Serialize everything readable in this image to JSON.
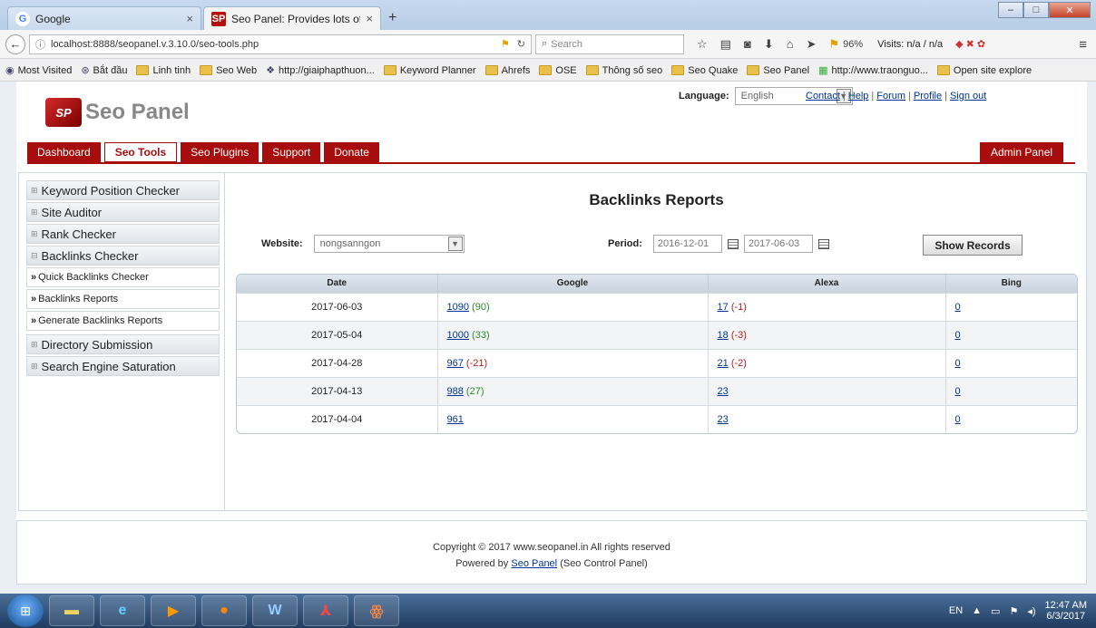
{
  "browser": {
    "tabs": [
      {
        "title": "Google",
        "favicon": "G"
      },
      {
        "title": "Seo Panel: Provides lots of hc",
        "favicon": "SP"
      }
    ],
    "url": "localhost:8888/seopanel.v.3.10.0/seo-tools.php",
    "search_placeholder": "Search",
    "zoom": "96%",
    "visits": "Visits: n/a / n/a",
    "bookmarks": [
      "Most Visited",
      "Bắt đầu",
      "Linh tinh",
      "Seo Web",
      "http://giaiphapthuon...",
      "Keyword Planner",
      "Ahrefs",
      "OSE",
      "Thông số seo",
      "Seo Quake",
      "Seo Panel",
      "http://www.traonguo...",
      "Open site explore"
    ]
  },
  "header": {
    "logo_mark": "SP",
    "logo_text": "Seo Panel",
    "language_label": "Language:",
    "language_value": "English",
    "links": [
      "Contact",
      "Help",
      "Forum",
      "Profile",
      "Sign out"
    ]
  },
  "menu": {
    "items": [
      "Dashboard",
      "Seo Tools",
      "Seo Plugins",
      "Support",
      "Donate"
    ],
    "active": "Seo Tools",
    "admin": "Admin Panel"
  },
  "sidebar": {
    "items": [
      {
        "label": "Keyword Position Checker"
      },
      {
        "label": "Site Auditor"
      },
      {
        "label": "Rank Checker"
      },
      {
        "label": "Backlinks Checker"
      },
      {
        "label": "Directory Submission"
      },
      {
        "label": "Search Engine Saturation"
      }
    ],
    "sub_items": [
      "Quick Backlinks Checker",
      "Backlinks Reports",
      "Generate Backlinks Reports"
    ]
  },
  "report": {
    "title": "Backlinks Reports",
    "website_label": "Website:",
    "website_value": "nongsanngon",
    "period_label": "Period:",
    "date_from": "2016-12-01",
    "date_to": "2017-06-03",
    "show_button": "Show Records",
    "columns": [
      "Date",
      "Google",
      "Alexa",
      "Bing"
    ],
    "rows": [
      {
        "date": "2017-06-03",
        "google": "1090",
        "google_diff": "(90)",
        "google_diff_sign": "pos",
        "alexa": "17",
        "alexa_diff": "(-1)",
        "alexa_diff_sign": "neg",
        "bing": "0"
      },
      {
        "date": "2017-05-04",
        "google": "1000",
        "google_diff": "(33)",
        "google_diff_sign": "pos",
        "alexa": "18",
        "alexa_diff": "(-3)",
        "alexa_diff_sign": "neg",
        "bing": "0"
      },
      {
        "date": "2017-04-28",
        "google": "967",
        "google_diff": "(-21)",
        "google_diff_sign": "neg",
        "alexa": "21",
        "alexa_diff": "(-2)",
        "alexa_diff_sign": "neg",
        "bing": "0"
      },
      {
        "date": "2017-04-13",
        "google": "988",
        "google_diff": "(27)",
        "google_diff_sign": "pos",
        "alexa": "23",
        "alexa_diff": "",
        "alexa_diff_sign": "",
        "bing": "0"
      },
      {
        "date": "2017-04-04",
        "google": "961",
        "google_diff": "",
        "google_diff_sign": "",
        "alexa": "23",
        "alexa_diff": "",
        "alexa_diff_sign": "",
        "bing": "0"
      }
    ]
  },
  "footer": {
    "copyright": "Copyright © 2017 www.seopanel.in All rights reserved",
    "powered_prefix": "Powered by",
    "powered_link": "Seo Panel",
    "powered_suffix": "(Seo Control Panel)"
  },
  "taskbar": {
    "lang": "EN",
    "time": "12:47 AM",
    "date": "6/3/2017"
  },
  "colors": {
    "brand_red": "#a80d0d",
    "link": "#003399",
    "positive": "#2e8b2e",
    "negative": "#b22222"
  }
}
